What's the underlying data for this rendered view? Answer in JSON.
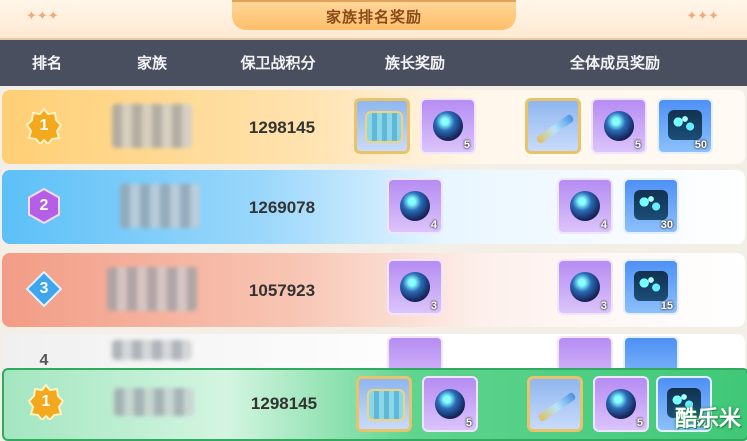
{
  "title": "家族排名奖励",
  "headers": [
    "排名",
    "家族",
    "保卫战积分",
    "族长奖励",
    "全体成员奖励"
  ],
  "rows": [
    {
      "rank": "1",
      "score": "1298145",
      "leader": [
        {
          "type": "chest",
          "qty": ""
        },
        {
          "type": "orb",
          "qty": "5"
        }
      ],
      "members": [
        {
          "type": "sword",
          "qty": ""
        },
        {
          "type": "orb",
          "qty": "5"
        },
        {
          "type": "crystal",
          "qty": "50"
        }
      ]
    },
    {
      "rank": "2",
      "score": "1269078",
      "leader": [
        {
          "type": "orb",
          "qty": "4"
        }
      ],
      "members": [
        {
          "type": "orb",
          "qty": "4"
        },
        {
          "type": "crystal",
          "qty": "30"
        }
      ]
    },
    {
      "rank": "3",
      "score": "1057923",
      "leader": [
        {
          "type": "orb",
          "qty": "3"
        }
      ],
      "members": [
        {
          "type": "orb",
          "qty": "3"
        },
        {
          "type": "crystal",
          "qty": "15"
        }
      ]
    },
    {
      "rank": "4",
      "score": "",
      "leader": [
        {
          "type": "orb",
          "qty": ""
        }
      ],
      "members": [
        {
          "type": "orb",
          "qty": ""
        },
        {
          "type": "crystal",
          "qty": ""
        }
      ]
    },
    {
      "rank": "1",
      "score": "1298145",
      "leader": [
        {
          "type": "chest",
          "qty": ""
        },
        {
          "type": "orb",
          "qty": "5"
        }
      ],
      "members": [
        {
          "type": "sword",
          "qty": ""
        },
        {
          "type": "orb",
          "qty": "5"
        },
        {
          "type": "crystal",
          "qty": "50"
        }
      ]
    }
  ],
  "watermark": "酷乐米"
}
